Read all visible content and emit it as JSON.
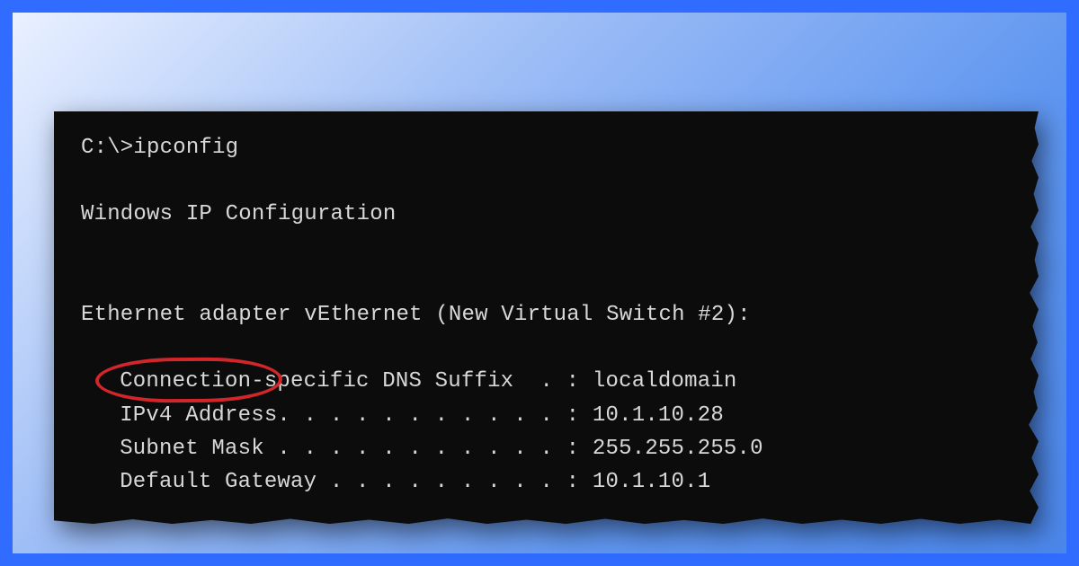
{
  "terminal": {
    "prompt": "C:\\>",
    "command": "ipconfig",
    "header": "Windows IP Configuration",
    "adapter_line": "Ethernet adapter vEthernet (New Virtual Switch #2):",
    "rows": {
      "dns_suffix": {
        "label": "Connection-specific DNS Suffix  . :",
        "value": "localdomain"
      },
      "ipv4": {
        "label": "IPv4 Address. . . . . . . . . . . :",
        "value": "10.1.10.28"
      },
      "subnet": {
        "label": "Subnet Mask . . . . . . . . . . . :",
        "value": "255.255.255.0"
      },
      "gateway": {
        "label": "Default Gateway . . . . . . . . . :",
        "value": "10.1.10.1"
      }
    }
  },
  "highlight": {
    "target": "subnet-mask-label"
  }
}
